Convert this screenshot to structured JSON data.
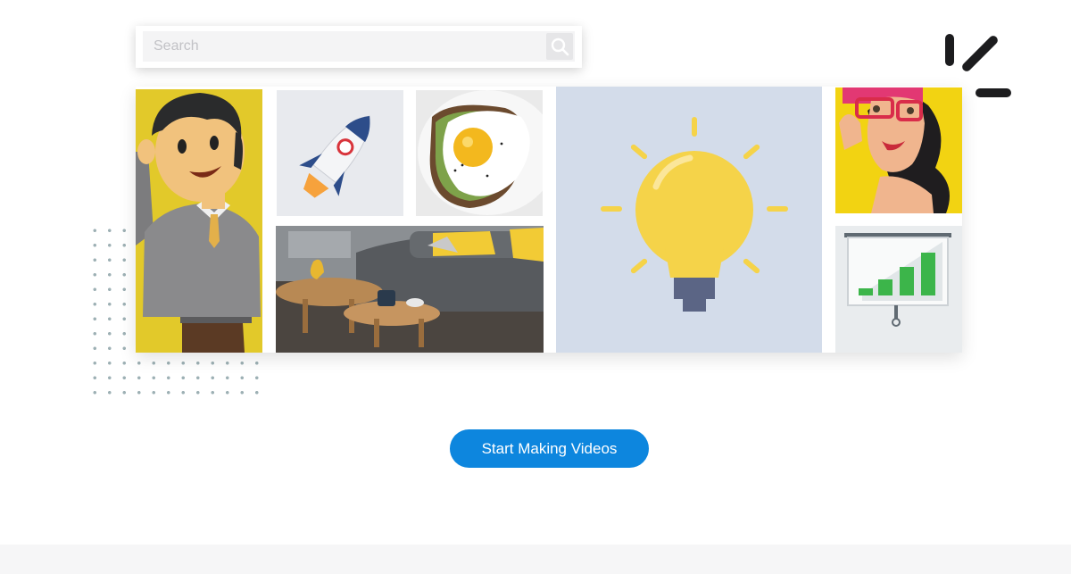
{
  "search": {
    "placeholder": "Search"
  },
  "cta": {
    "label": "Start Making Videos"
  },
  "icons": {
    "search": "search-icon",
    "logo": "brand-logo-icon"
  },
  "colors": {
    "accent": "#0d86de",
    "tile_yellow": "#e4cc2c",
    "bulb": "#f5d349",
    "bulb_bg": "#d3dcea",
    "chart_green": "#3cb54a"
  }
}
